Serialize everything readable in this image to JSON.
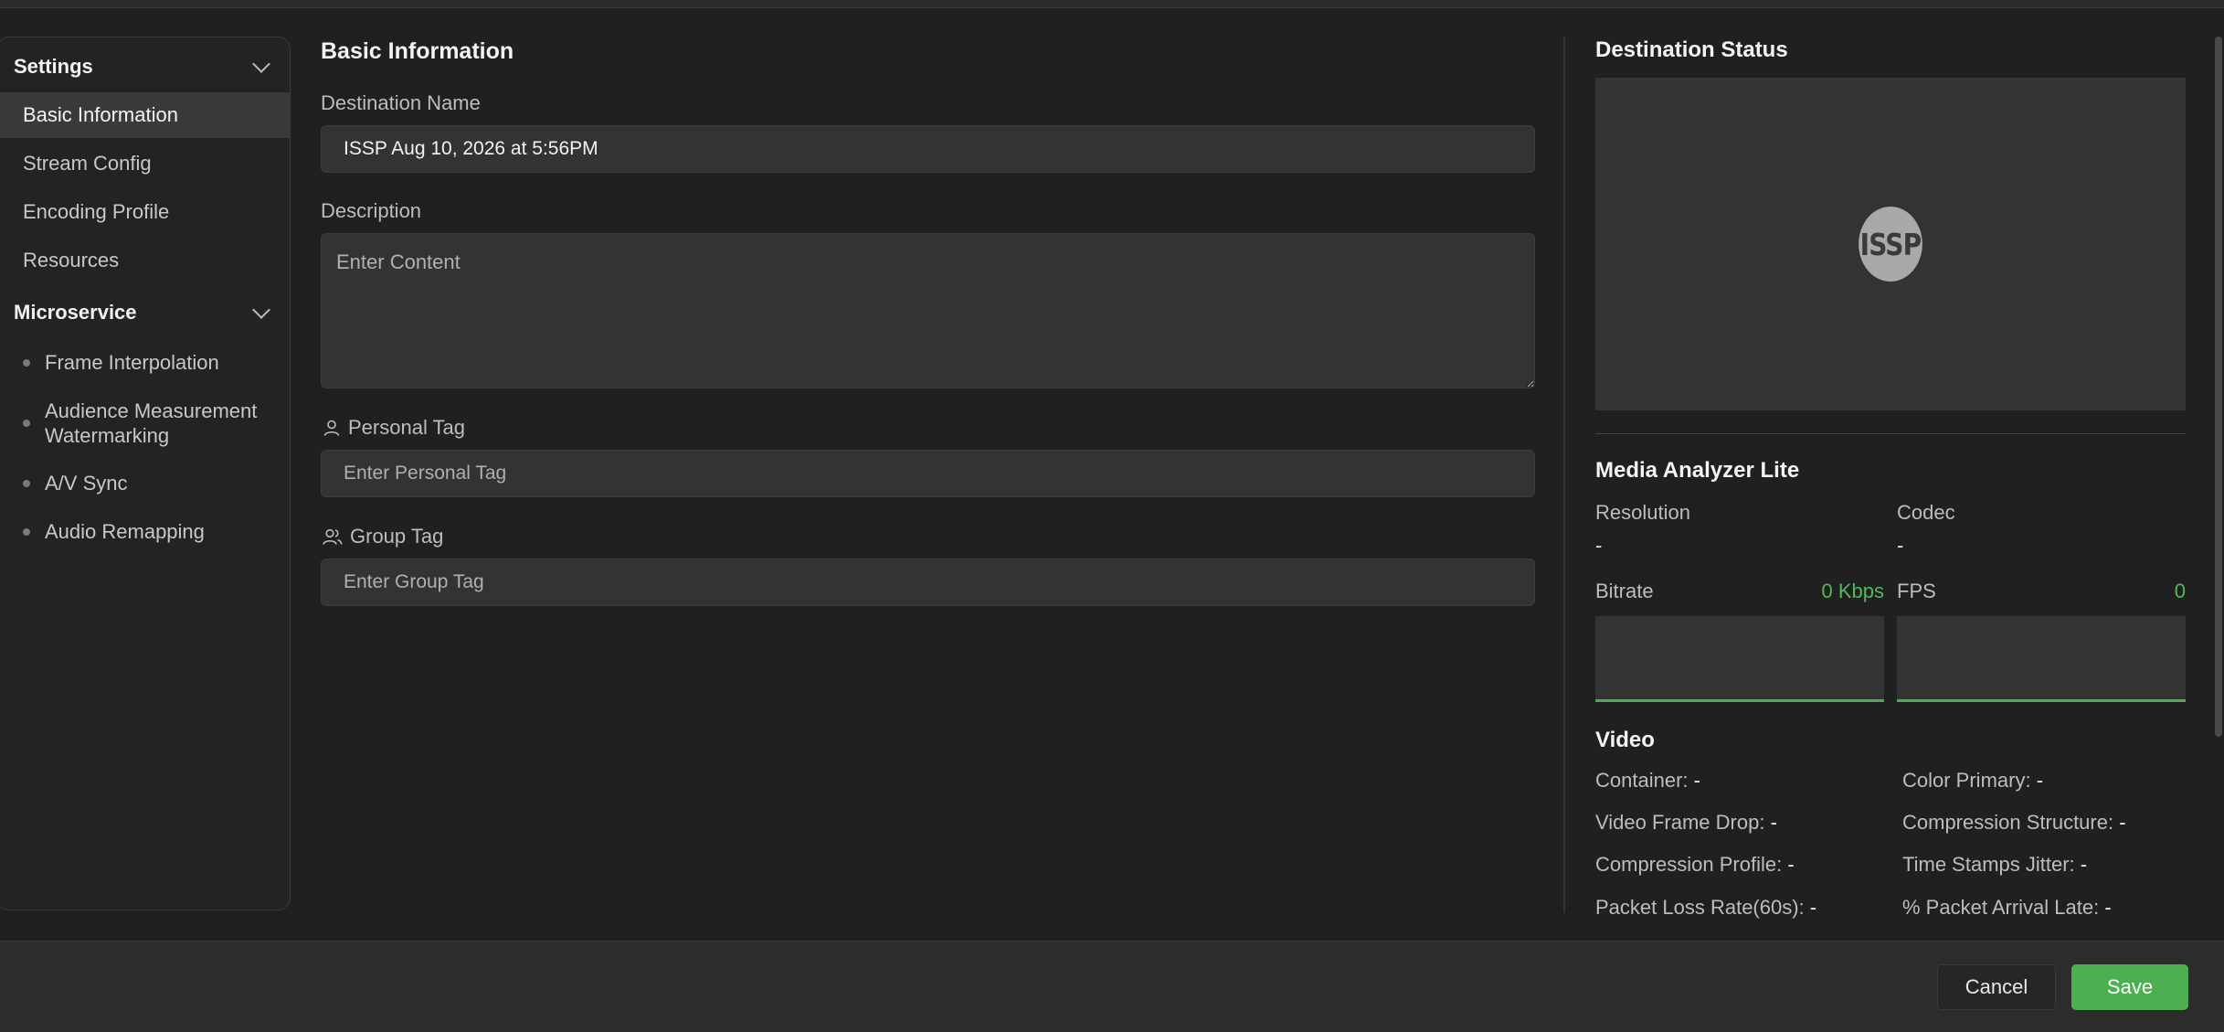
{
  "sidebar": {
    "settings_title": "Settings",
    "settings_items": [
      "Basic Information",
      "Stream Config",
      "Encoding Profile",
      "Resources"
    ],
    "microservice_title": "Microservice",
    "microservice_items": [
      "Frame Interpolation",
      "Audience Measurement Watermarking",
      "A/V Sync",
      "Audio Remapping"
    ]
  },
  "form": {
    "title": "Basic Information",
    "destination_name_label": "Destination Name",
    "destination_name_value": "ISSP Aug 10, 2026 at 5:56PM",
    "description_label": "Description",
    "description_placeholder": "Enter Content",
    "personal_tag_label": "Personal Tag",
    "personal_tag_placeholder": "Enter Personal Tag",
    "group_tag_label": "Group Tag",
    "group_tag_placeholder": "Enter Group Tag"
  },
  "status": {
    "title": "Destination Status",
    "logo_text": "ISSP"
  },
  "analyzer": {
    "title": "Media Analyzer Lite",
    "resolution_label": "Resolution",
    "resolution_value": "-",
    "codec_label": "Codec",
    "codec_value": "-",
    "bitrate_label": "Bitrate",
    "bitrate_value": "0 Kbps",
    "fps_label": "FPS",
    "fps_value": "0",
    "accent_color": "#4caf50"
  },
  "video": {
    "title": "Video",
    "left": [
      {
        "label": "Container:",
        "value": "-"
      },
      {
        "label": "Video Frame Drop:",
        "value": "-"
      },
      {
        "label": "Compression Profile:",
        "value": "-"
      },
      {
        "label": "Packet Loss Rate(60s):",
        "value": "-"
      }
    ],
    "right": [
      {
        "label": "Color Primary:",
        "value": "-"
      },
      {
        "label": "Compression Structure:",
        "value": "-"
      },
      {
        "label": "Time Stamps Jitter:",
        "value": "-"
      },
      {
        "label": "% Packet Arrival Late:",
        "value": "-"
      }
    ]
  },
  "footer": {
    "cancel_label": "Cancel",
    "save_label": "Save"
  }
}
